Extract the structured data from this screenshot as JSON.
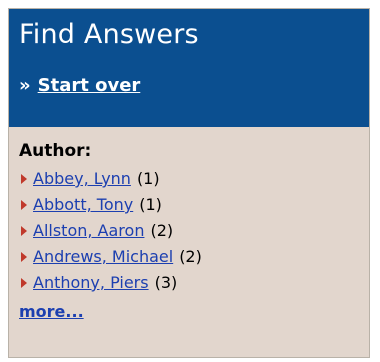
{
  "header": {
    "title": "Find Answers",
    "start_over_prefix": "»",
    "start_over_label": "Start over"
  },
  "facet": {
    "title": "Author:",
    "items": [
      {
        "label": "Abbey, Lynn",
        "count": "(1)"
      },
      {
        "label": "Abbott, Tony",
        "count": "(1)"
      },
      {
        "label": "Allston, Aaron",
        "count": "(2)"
      },
      {
        "label": "Andrews, Michael",
        "count": "(2)"
      },
      {
        "label": "Anthony, Piers",
        "count": "(3)"
      }
    ],
    "more_label": "more..."
  },
  "colors": {
    "header_bg": "#0b4f90",
    "panel_bg": "#e2d6cd",
    "link": "#1c3fb0",
    "arrow": "#c0392b"
  }
}
